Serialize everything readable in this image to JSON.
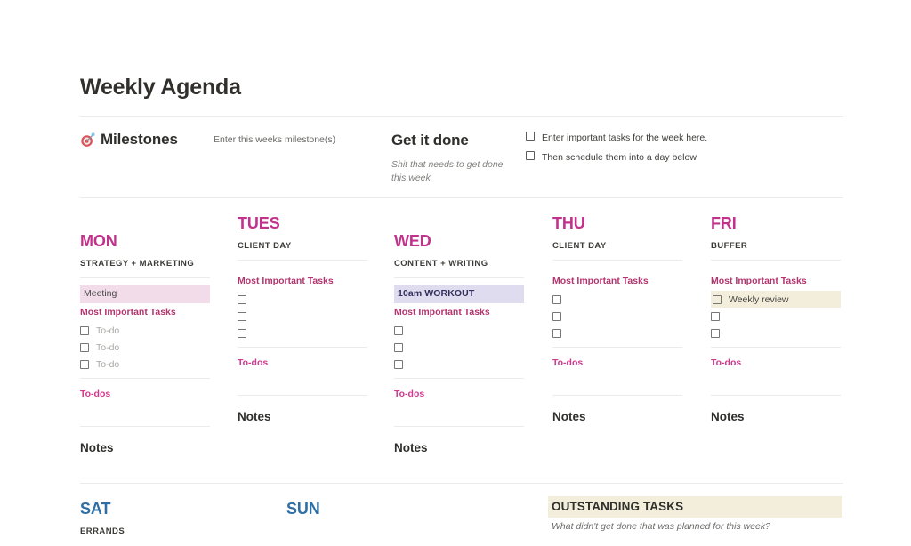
{
  "header": {
    "title": "Weekly Agenda"
  },
  "milestones": {
    "icon": "target-icon",
    "label": "Milestones",
    "hint": "Enter this weeks milestone(s)"
  },
  "get_it_done": {
    "title": "Get it done",
    "subtitle": "Shit that needs to get done this week",
    "checklist": [
      {
        "label": "Enter important tasks for the week here."
      },
      {
        "label": "Then schedule them into a day below"
      }
    ]
  },
  "labels": {
    "most_important_tasks": "Most Important Tasks",
    "todos": "To-dos",
    "notes": "Notes",
    "todo_placeholder": "To-do"
  },
  "colors": {
    "day_pink": "#c2328b",
    "day_blue": "#2f6fa3",
    "mit_pink": "#b4346f",
    "todos_pink": "#cf3a8e",
    "chip_pink_bg": "#f2dcea",
    "chip_purple_bg": "#dedcee",
    "chip_purple_text": "#32305c",
    "highlight_cream": "#f3eedb",
    "rule": "#ebebea"
  },
  "weekdays": [
    {
      "name": "MON",
      "subtitle": "STRATEGY + MARKETING",
      "event": {
        "text": "Meeting",
        "style": "pink"
      },
      "tasks": [
        {
          "text": "To-do",
          "highlight": false
        },
        {
          "text": "To-do",
          "highlight": false
        },
        {
          "text": "To-do",
          "highlight": false
        }
      ]
    },
    {
      "name": "TUES",
      "subtitle": "CLIENT DAY",
      "event": null,
      "tasks": [
        {
          "text": "",
          "highlight": false
        },
        {
          "text": "",
          "highlight": false
        },
        {
          "text": "",
          "highlight": false
        }
      ]
    },
    {
      "name": "WED",
      "subtitle": "CONTENT + WRITING",
      "event": {
        "text": "10am WORKOUT",
        "style": "purple"
      },
      "tasks": [
        {
          "text": "",
          "highlight": false
        },
        {
          "text": "",
          "highlight": false
        },
        {
          "text": "",
          "highlight": false
        }
      ]
    },
    {
      "name": "THU",
      "subtitle": "CLIENT DAY",
      "event": null,
      "tasks": [
        {
          "text": "",
          "highlight": false
        },
        {
          "text": "",
          "highlight": false
        },
        {
          "text": "",
          "highlight": false
        }
      ]
    },
    {
      "name": "FRI",
      "subtitle": "BUFFER",
      "event": null,
      "tasks": [
        {
          "text": "Weekly review",
          "highlight": true
        },
        {
          "text": "",
          "highlight": false
        },
        {
          "text": "",
          "highlight": false
        }
      ]
    }
  ],
  "weekend": [
    {
      "name": "SAT",
      "subtitle": "ERRANDS"
    },
    {
      "name": "SUN",
      "subtitle": ""
    }
  ],
  "outstanding": {
    "title": "OUTSTANDING TASKS",
    "subtitle": "What didn't get done that was planned for this week?"
  }
}
